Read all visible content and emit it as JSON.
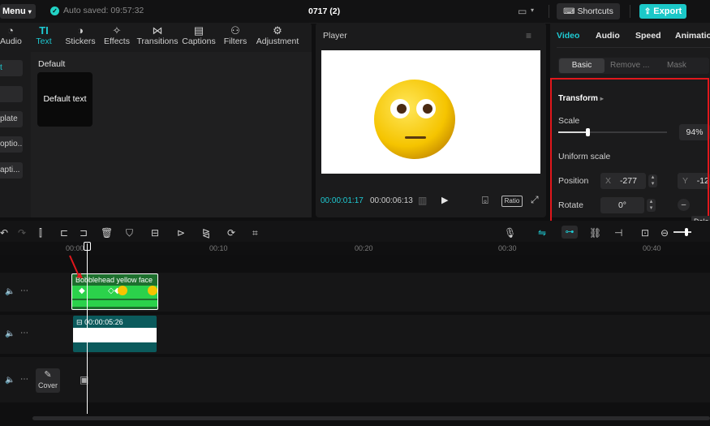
{
  "topbar": {
    "menu": "Menu",
    "autosave": "Auto saved: 09:57:32",
    "project_title": "0717 (2)",
    "shortcuts": "Shortcuts",
    "export": "Export"
  },
  "media_tabs": [
    {
      "label": "Audio",
      "icon": "audio-icon"
    },
    {
      "label": "Text",
      "icon": "text-icon"
    },
    {
      "label": "Stickers",
      "icon": "sticker-icon"
    },
    {
      "label": "Effects",
      "icon": "effects-icon"
    },
    {
      "label": "Transitions",
      "icon": "transitions-icon"
    },
    {
      "label": "Captions",
      "icon": "captions-icon"
    },
    {
      "label": "Filters",
      "icon": "filters-icon"
    },
    {
      "label": "Adjustment",
      "icon": "adjustment-icon"
    }
  ],
  "text_sidebar": [
    "t",
    "",
    "plate",
    "optio...",
    "apti..."
  ],
  "text_panel": {
    "section": "Default",
    "card_label": "Default text"
  },
  "player": {
    "title": "Player",
    "current_time": "00:00:01:17",
    "total_time": "00:00:06:13",
    "ratio": "Ratio"
  },
  "properties": {
    "tabs": [
      "Video",
      "Audio",
      "Speed",
      "Animation"
    ],
    "subtabs": [
      "Basic",
      "Remove ...",
      "Mask"
    ],
    "section": "Transform",
    "scale_label": "Scale",
    "scale_value": "94%",
    "scale_fraction": 0.94,
    "uniform_scale": "Uniform scale",
    "position_label": "Position",
    "x_label": "X",
    "x_value": "-277",
    "y_label": "Y",
    "y_value": "-12",
    "rotate_label": "Rotate",
    "rotate_value": "0°",
    "tooltip": "Dele"
  },
  "timeline": {
    "ruler": [
      "00:00",
      "00:10",
      "00:20",
      "00:30",
      "00:40"
    ],
    "video_clip_label": "Bobblehead yellow face",
    "text_clip_duration": "00:00:05:26",
    "cover_label": "Cover"
  },
  "colors": {
    "accent": "#1ecad3",
    "export": "#1bc8c8",
    "highlight": "#e1171c",
    "clip_green": "#2bd24b",
    "clip_teal": "#0b5a5c"
  }
}
